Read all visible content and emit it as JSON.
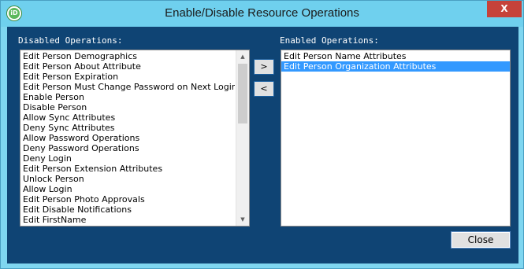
{
  "window": {
    "title": "Enable/Disable Resource Operations",
    "app_icon_label": "iD",
    "close_glyph": "X"
  },
  "disabled": {
    "label": "Disabled Operations:",
    "items": [
      "Edit Person Demographics",
      "Edit Person About Attribute",
      "Edit Person Expiration",
      "Edit Person Must Change Password on Next Login",
      "Enable Person",
      "Disable Person",
      "Allow Sync Attributes",
      "Deny Sync Attributes",
      "Allow Password Operations",
      "Deny Password Operations",
      "Deny Login",
      "Edit Person Extension Attributes",
      "Unlock Person",
      "Allow Login",
      "Edit Person Photo Approvals",
      "Edit Disable Notifications",
      "Edit FirstName"
    ]
  },
  "enabled": {
    "label": "Enabled Operations:",
    "items": [
      "Edit Person Name Attributes",
      "Edit Person Organization Attributes"
    ],
    "selected_index": 1
  },
  "buttons": {
    "enable": ">",
    "disable": "<",
    "close": "Close"
  },
  "scrollbar": {
    "up_glyph": "▲",
    "down_glyph": "▼"
  },
  "colors": {
    "title_bar": "#6fd0ee",
    "client_bg": "#0f4474",
    "selection": "#3399ff",
    "close_x": "#c6423a"
  }
}
